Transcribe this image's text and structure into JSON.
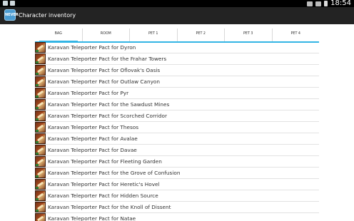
{
  "status_bar": {
    "time": "18:54"
  },
  "app": {
    "title": "Character inventory",
    "logo_text": "NEVER"
  },
  "tabs": [
    {
      "label": "BAG",
      "active": true
    },
    {
      "label": "ROOM",
      "active": false
    },
    {
      "label": "PET 1",
      "active": false
    },
    {
      "label": "PET 2",
      "active": false
    },
    {
      "label": "PET 3",
      "active": false
    },
    {
      "label": "PET 4",
      "active": false
    }
  ],
  "items": [
    {
      "name": "Karavan Teleporter Pact for Dyron",
      "icon": "teleporter-pact-icon"
    },
    {
      "name": "Karavan Teleporter Pact for the Frahar Towers",
      "icon": "teleporter-pact-icon"
    },
    {
      "name": "Karavan Teleporter Pact for Oflovak's Oasis",
      "icon": "teleporter-pact-icon"
    },
    {
      "name": "Karavan Teleporter Pact for Outlaw Canyon",
      "icon": "teleporter-pact-icon"
    },
    {
      "name": "Karavan Teleporter Pact for Pyr",
      "icon": "teleporter-pact-icon"
    },
    {
      "name": "Karavan Teleporter Pact for the Sawdust Mines",
      "icon": "teleporter-pact-icon"
    },
    {
      "name": "Karavan Teleporter Pact for Scorched Corridor",
      "icon": "teleporter-pact-icon"
    },
    {
      "name": "Karavan Teleporter Pact for Thesos",
      "icon": "teleporter-pact-icon"
    },
    {
      "name": "Karavan Teleporter Pact for Avalae",
      "icon": "teleporter-pact-icon"
    },
    {
      "name": "Karavan Teleporter Pact for Davae",
      "icon": "teleporter-pact-icon"
    },
    {
      "name": "Karavan Teleporter Pact for Fleeting Garden",
      "icon": "teleporter-pact-icon"
    },
    {
      "name": "Karavan Teleporter Pact for the Grove of Confusion",
      "icon": "teleporter-pact-icon"
    },
    {
      "name": "Karavan Teleporter Pact for Heretic's Hovel",
      "icon": "teleporter-pact-icon"
    },
    {
      "name": "Karavan Teleporter Pact for Hidden Source",
      "icon": "teleporter-pact-icon"
    },
    {
      "name": "Karavan Teleporter Pact for the Knoll of Dissent",
      "icon": "teleporter-pact-icon"
    },
    {
      "name": "Karavan Teleporter Pact for Natae",
      "icon": "teleporter-pact-icon"
    }
  ]
}
